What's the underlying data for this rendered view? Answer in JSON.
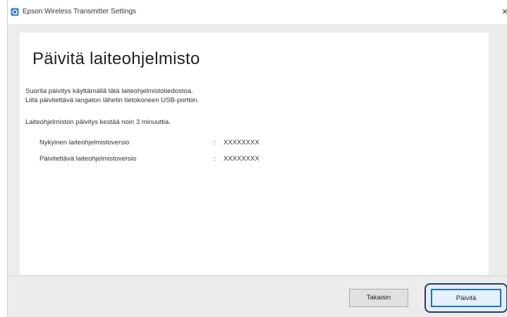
{
  "window": {
    "title": "Epson Wireless Transmitter Settings",
    "close_glyph": "×"
  },
  "page": {
    "title": "Päivitä laiteohjelmisto",
    "line1": "Suorita päivitys käyttämällä tätä laiteohjelmistotiedostoa.",
    "line2": "Liitä päivitettävä langaton lähetin tietokoneen USB-porttiin.",
    "line3": "Laiteohjelmiston päivitys kestää noin 3 minuuttia."
  },
  "versions": [
    {
      "label": "Nykyinen laiteohjelmistoversio",
      "separator": ":",
      "value": "XXXXXXXX"
    },
    {
      "label": "Päivitettävä laiteohjelmistoversio",
      "separator": ":",
      "value": "XXXXXXXX"
    }
  ],
  "buttons": {
    "back": "Takaisin",
    "update": "Päivitä"
  },
  "icons": {
    "app": "epson-app-icon",
    "close": "close-icon"
  },
  "colors": {
    "accent": "#0078d7",
    "highlight_ring": "#1f3f6e",
    "background": "#ececec"
  }
}
